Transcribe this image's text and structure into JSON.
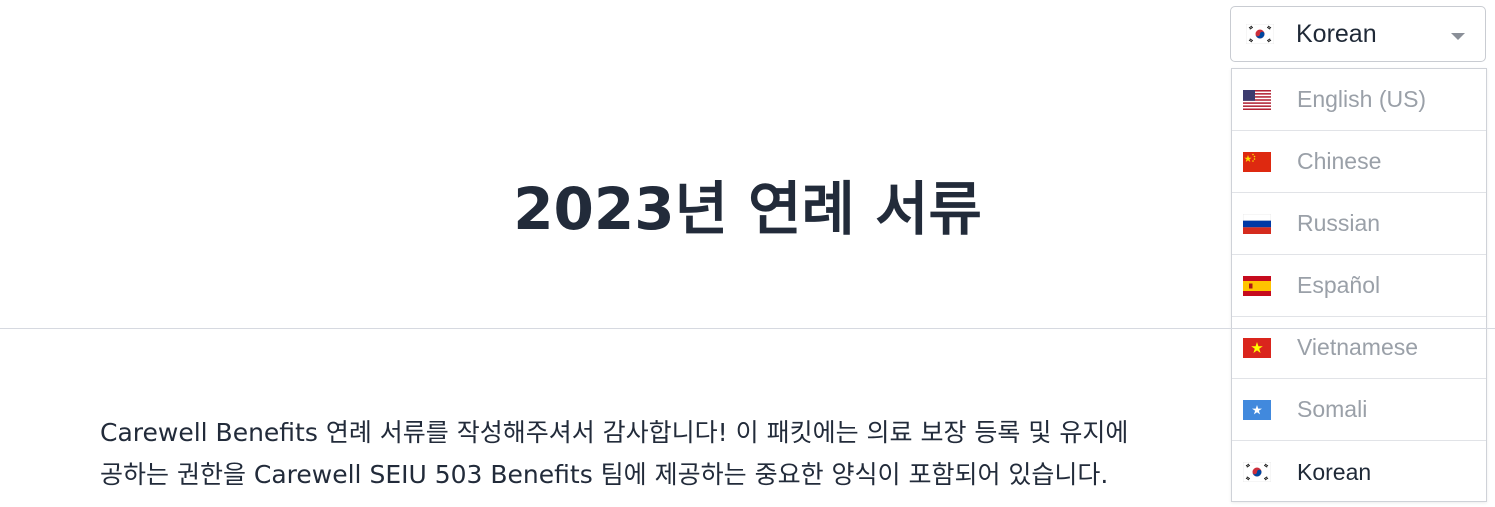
{
  "page": {
    "title": "2023년 연례 서류",
    "body_lines": [
      "Carewell Benefits 연례 서류를 작성해주셔서 감사합니다! 이 패킷에는 의료 보장 등록 및 유지에",
      "공하는 권한을 Carewell SEIU 503 Benefits 팀에 제공하는 중요한 양식이 포함되어 있습니다."
    ]
  },
  "language_select": {
    "selected_label": "Korean",
    "selected_flag": "korea-flag-icon",
    "options": [
      {
        "label": "English (US)",
        "flag": "us-flag-icon"
      },
      {
        "label": "Chinese",
        "flag": "china-flag-icon"
      },
      {
        "label": "Russian",
        "flag": "russia-flag-icon"
      },
      {
        "label": "Español",
        "flag": "spain-flag-icon"
      },
      {
        "label": "Vietnamese",
        "flag": "vietnam-flag-icon"
      },
      {
        "label": "Somali",
        "flag": "somalia-flag-icon"
      },
      {
        "label": "Korean",
        "flag": "korea-flag-icon"
      }
    ]
  },
  "colors": {
    "title_text": "#222b3a",
    "option_text_muted": "#9aa0a8",
    "option_text_selected": "#1f2937",
    "border": "#c9ccd2"
  }
}
